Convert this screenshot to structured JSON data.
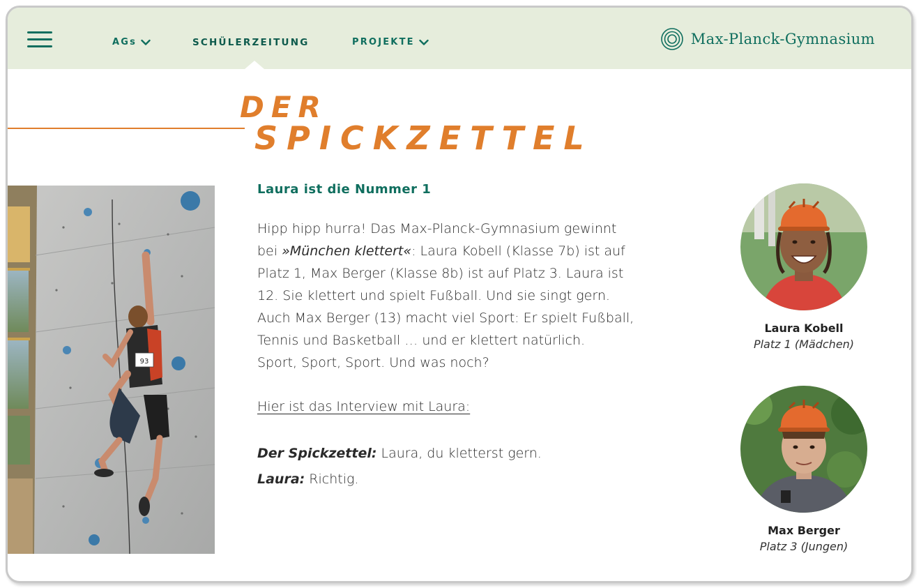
{
  "nav": {
    "items": [
      {
        "label": "AGs",
        "has_dropdown": true
      },
      {
        "label": "SCHÜLERZEITUNG",
        "has_dropdown": false,
        "active": true
      },
      {
        "label": "PROJEKTE",
        "has_dropdown": true
      }
    ],
    "brand": "Max-Planck-Gymnasium",
    "icons": {
      "menu": "hamburger-icon",
      "brand": "concentric-circles-logo",
      "dropdown": "chevron-down-icon"
    }
  },
  "colors": {
    "accent_green": "#0f6e5e",
    "header_bg": "#e6eddc",
    "title_orange": "#e07e2c"
  },
  "page": {
    "title_line1": "DER",
    "title_line2": "SPICKZETTEL"
  },
  "article": {
    "heading": "Laura ist die Nummer 1",
    "body_lines": [
      "Hipp hipp hurra! Das Max-Planck-Gymnasium gewinnt",
      "bei ",
      "»München klettert«",
      ": Laura Kobell (Klasse 7b) ist auf",
      "Platz 1, Max Berger (Klasse 8b) ist auf Platz 3. Laura ist",
      "12. Sie klettert und spielt Fußball. Und sie singt gern.",
      "Auch Max Berger (13) macht viel Sport: Er spielt Fußball,",
      "Tennis und Basketball … und er klettert natürlich.",
      "Sport, Sport, Sport. Und was noch?"
    ],
    "interview_link": "Hier ist das Interview mit Laura:",
    "interview": [
      {
        "speaker": "Der Spickzettel:",
        "text": " Laura, du kletterst gern."
      },
      {
        "speaker": "Laura:",
        "text": " Richtig."
      }
    ]
  },
  "people": [
    {
      "name": "Laura Kobell",
      "place": "Platz 1 (Mädchen)"
    },
    {
      "name": "Max Berger",
      "place": "Platz 3 (Jungen)"
    }
  ],
  "photo": {
    "bib_number": "93"
  }
}
